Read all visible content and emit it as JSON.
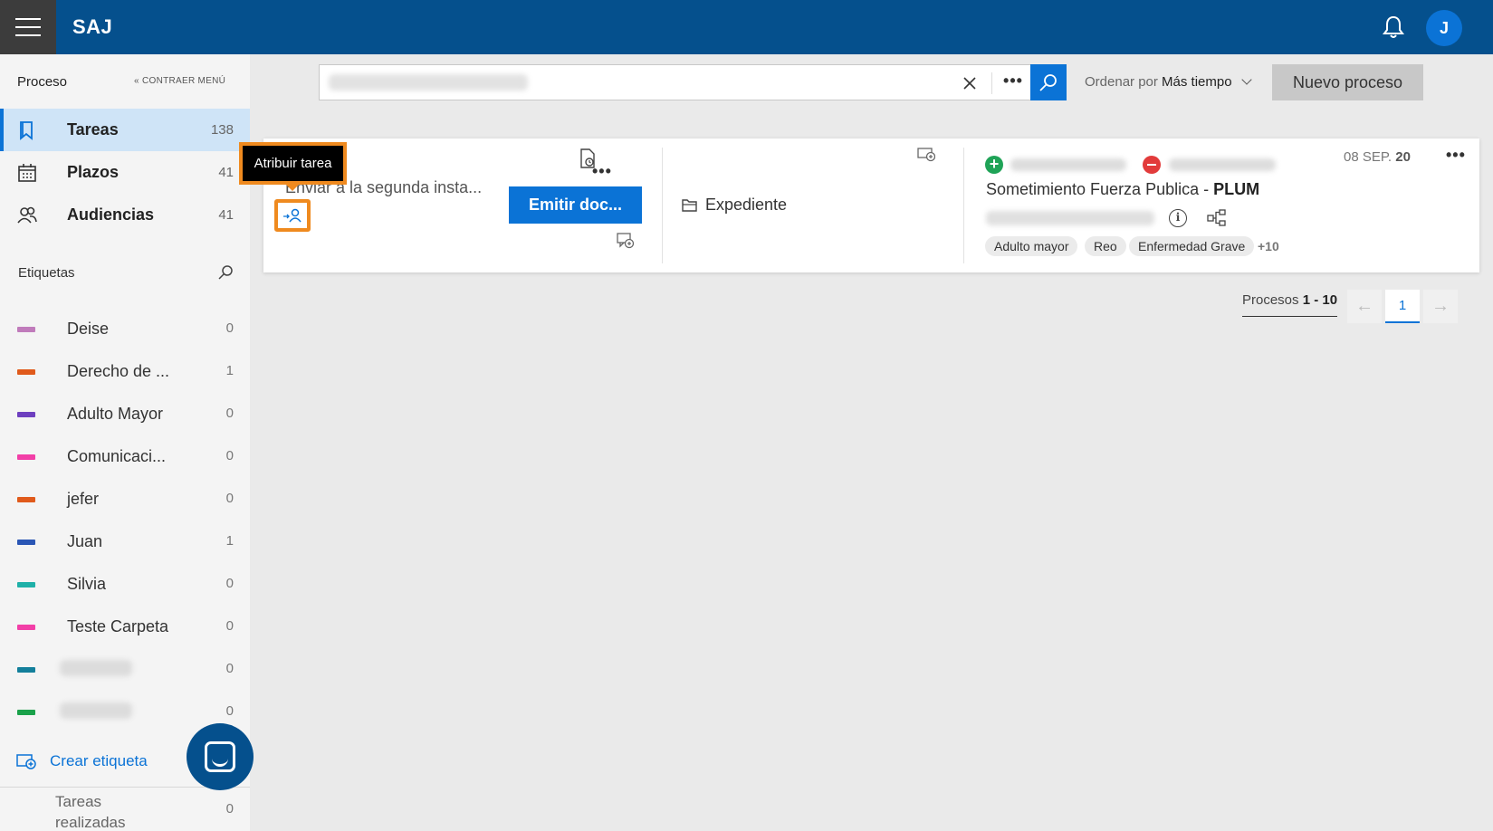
{
  "app": {
    "title": "SAJ",
    "user_initial": "J"
  },
  "sidebar": {
    "section_label": "Proceso",
    "collapse_label": "CONTRAER MENÚ",
    "nav": [
      {
        "label": "Tareas",
        "count": "138",
        "icon": "bookmark-icon",
        "active": true
      },
      {
        "label": "Plazos",
        "count": "41",
        "icon": "calendar-icon",
        "active": false
      },
      {
        "label": "Audiencias",
        "count": "41",
        "icon": "people-icon",
        "active": false
      }
    ],
    "tags_label": "Etiquetas",
    "tags": [
      {
        "label": "Deise",
        "count": "0",
        "color": "#c07bbb"
      },
      {
        "label": "Derecho de ...",
        "count": "1",
        "color": "#e05a1b"
      },
      {
        "label": "Adulto Mayor",
        "count": "0",
        "color": "#6d3fbf"
      },
      {
        "label": "Comunicaci...",
        "count": "0",
        "color": "#f23fa7"
      },
      {
        "label": "jefer",
        "count": "0",
        "color": "#e05a1b"
      },
      {
        "label": "Juan",
        "count": "1",
        "color": "#2a56b5"
      },
      {
        "label": "Silvia",
        "count": "0",
        "color": "#1fb0a8"
      },
      {
        "label": "Teste Carpeta",
        "count": "0",
        "color": "#f23fa7"
      },
      {
        "label": "",
        "count": "0",
        "color": "#137f9b"
      },
      {
        "label": "",
        "count": "0",
        "color": "#1aa14a"
      }
    ],
    "create_tag": "Crear etiqueta",
    "done_label": "Tareas realizadas",
    "done_count": "0"
  },
  "toolbar": {
    "search_value": "",
    "sort_prefix": "Ordenar por",
    "sort_value": "Más tiempo",
    "new_process": "Nuevo proceso"
  },
  "card": {
    "task_text": "Enviar a la segunda insta...",
    "tooltip": "Atribuir tarea",
    "emit_button": "Emitir doc...",
    "expediente": "Expediente",
    "date_prefix": "08 SEP.",
    "date_year": "20",
    "title_main": "Sometimiento Fuerza Publica - ",
    "title_bold": "PLUM",
    "chips": [
      "Adulto mayor",
      "Reo",
      "Enfermedad Grave"
    ],
    "more_chips": "+10"
  },
  "pagination": {
    "label": "Procesos",
    "range": "1 - 10",
    "current_page": "1"
  },
  "colors": {
    "brand": "#05508d",
    "accent": "#0b73d6",
    "highlight": "#ef8a1f"
  }
}
